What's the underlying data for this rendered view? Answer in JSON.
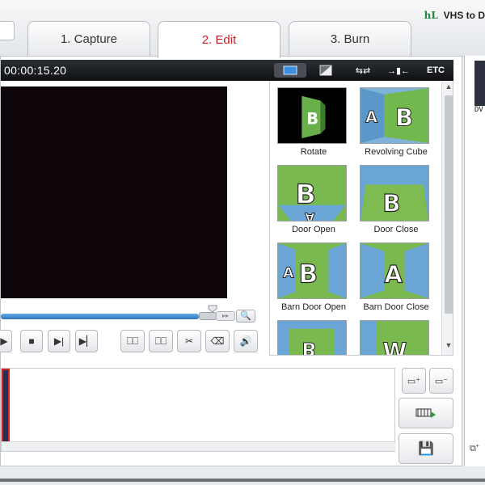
{
  "app": {
    "title_fragment": "VHS to D"
  },
  "tabs": [
    {
      "label": "1. Capture",
      "active": false
    },
    {
      "label": "2. Edit",
      "active": true
    },
    {
      "label": "3. Burn",
      "active": false
    }
  ],
  "player": {
    "timecode": "00:00:15.20"
  },
  "effects_toolbar": {
    "etc_label": "ETC"
  },
  "effects": [
    {
      "label": "Rotate",
      "icon": "rotate-transition-icon"
    },
    {
      "label": "Revolving Cube",
      "icon": "revolving-cube-transition-icon"
    },
    {
      "label": "Door Open",
      "icon": "door-open-transition-icon"
    },
    {
      "label": "Door Close",
      "icon": "door-close-transition-icon"
    },
    {
      "label": "Barn Door Open",
      "icon": "barn-door-open-transition-icon"
    },
    {
      "label": "Barn Door Close",
      "icon": "barn-door-close-transition-icon"
    }
  ],
  "right_panel": {
    "label": "DV"
  },
  "colors": {
    "active_tab_text": "#c8202a",
    "toolbar_bg": "#15181c",
    "video_bg": "#0d0509",
    "seek_fill": "#3a86cf",
    "selected_clip_border": "#d2232a"
  }
}
